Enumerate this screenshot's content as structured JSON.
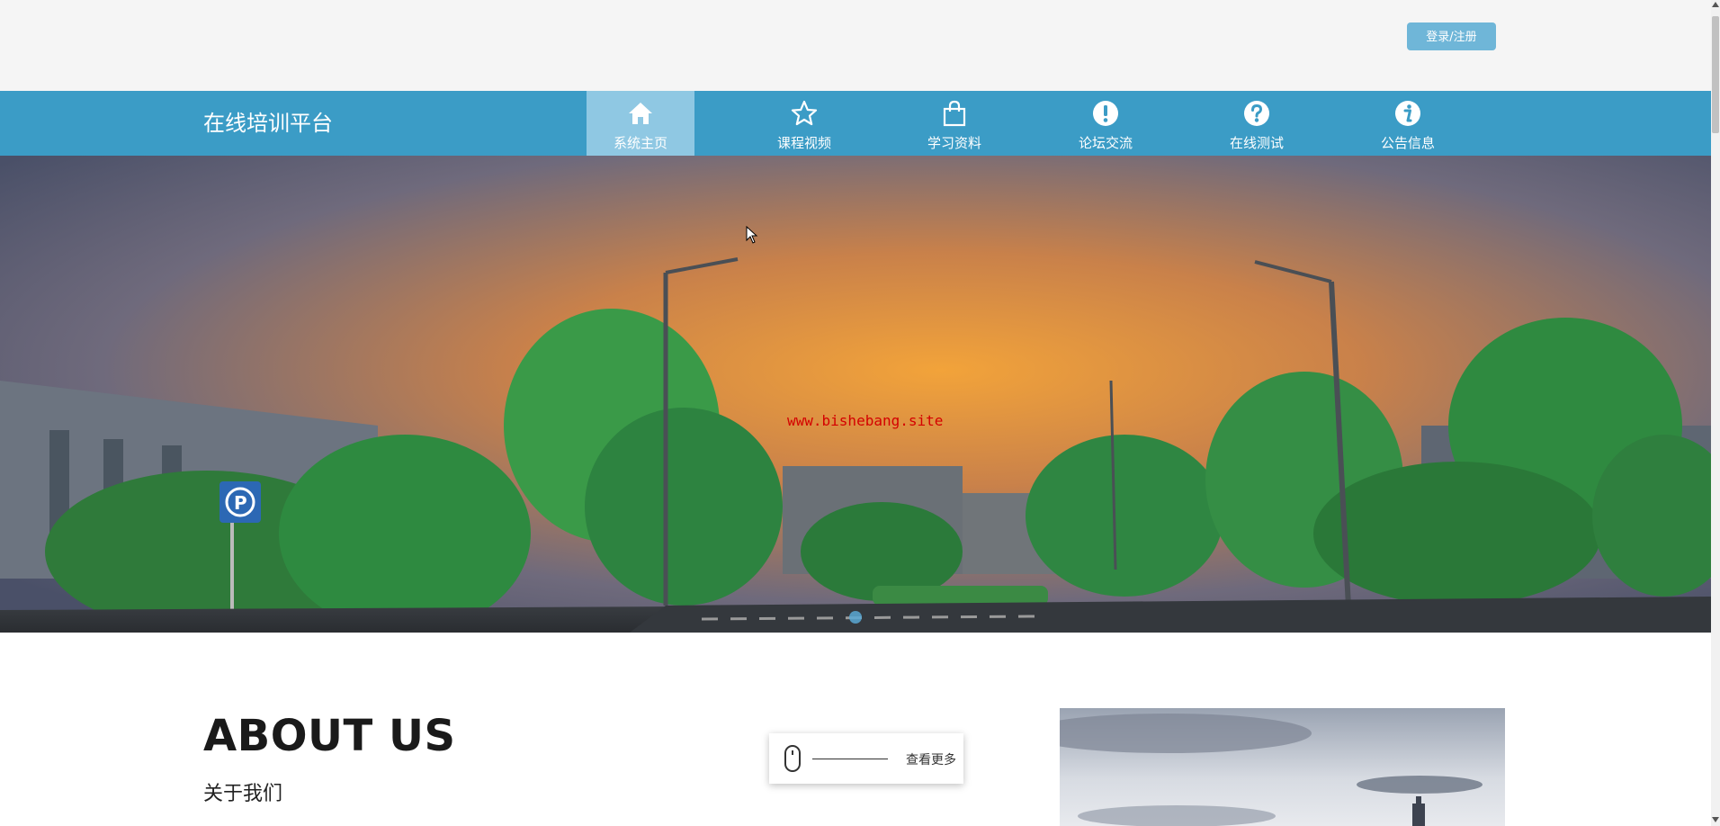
{
  "header": {
    "login_label": "登录/注册"
  },
  "navbar": {
    "brand": "在线培训平台",
    "items": [
      {
        "label": "系统主页",
        "icon": "home-icon",
        "active": true
      },
      {
        "label": "课程视频",
        "icon": "star-icon",
        "active": false
      },
      {
        "label": "学习资料",
        "icon": "shopping-bag-icon",
        "active": false
      },
      {
        "label": "论坛交流",
        "icon": "exclamation-icon",
        "active": false
      },
      {
        "label": "在线测试",
        "icon": "question-icon",
        "active": false
      },
      {
        "label": "公告信息",
        "icon": "info-icon",
        "active": false
      }
    ]
  },
  "hero": {
    "watermark": "www.bishebang.site",
    "slide_indicator": "1"
  },
  "about": {
    "title": "ABOUT US",
    "subtitle": "关于我们",
    "more_label": "查看更多"
  },
  "colors": {
    "navbar": "#3b9cc6",
    "nav_active": "#8fc8e3",
    "login_button": "#6fb6d8",
    "topbar": "#f5f5f5"
  }
}
